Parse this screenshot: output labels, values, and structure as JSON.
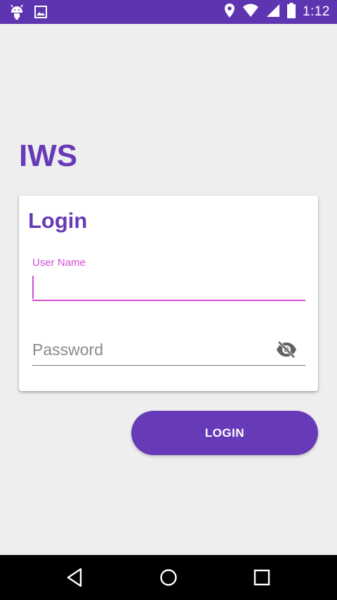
{
  "status_bar": {
    "time": "1:12",
    "left_icons": [
      "android-icon",
      "image-icon"
    ],
    "right_icons": [
      "location-icon",
      "wifi-icon",
      "signal-icon",
      "battery-icon"
    ],
    "color": "#5e35b1"
  },
  "app": {
    "title": "IWS",
    "accent_color": "#673ab7",
    "focus_color": "#d14fd6"
  },
  "login_card": {
    "title": "Login",
    "username": {
      "label": "User Name",
      "value": ""
    },
    "password": {
      "placeholder": "Password",
      "value": "",
      "toggle_icon": "visibility-off-icon"
    }
  },
  "login_button": {
    "label": "LOGIN"
  },
  "nav_bar": {
    "buttons": [
      "back-icon",
      "home-icon",
      "recents-icon"
    ]
  }
}
